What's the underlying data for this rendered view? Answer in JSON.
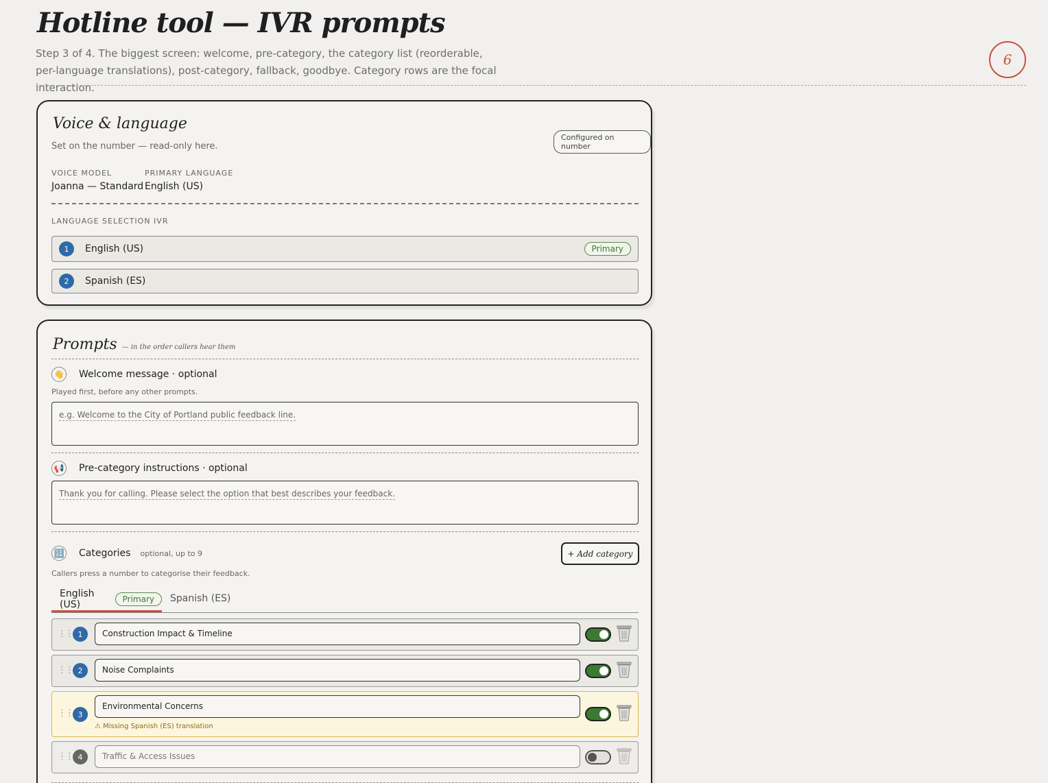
{
  "header": {
    "title": "Hotline tool — IVR prompts",
    "subtitle": "Step 3 of 4. The biggest screen: welcome, pre-category, the category list (reorderable, per-language translations), post-category, fallback, goodbye. Category rows are the focal interaction.",
    "step_number": "6"
  },
  "voice_card": {
    "title": "Voice & language",
    "subtitle": "Set on the number — read-only here.",
    "badge": "Configured on number",
    "voice_model_label": "VOICE MODEL",
    "voice_model_value": "Joanna — Standard",
    "primary_language_label": "PRIMARY LANGUAGE",
    "primary_language_value": "English (US)",
    "language_ivr_label": "LANGUAGE SELECTION IVR",
    "languages": [
      {
        "number": "1",
        "name": "English (US)",
        "badge": "Primary"
      },
      {
        "number": "2",
        "name": "Spanish (ES)",
        "badge": ""
      }
    ]
  },
  "prompts_card": {
    "title": "Prompts",
    "title_note": "— in the order callers hear them",
    "welcome": {
      "icon": "waving-hand-icon",
      "label": "Welcome message · optional",
      "hint": "Played first, before any other prompts.",
      "placeholder": "e.g. Welcome to the City of Portland public feedback line."
    },
    "pre_category": {
      "icon": "megaphone-icon",
      "label": "Pre-category instructions · optional",
      "placeholder": "Thank you for calling. Please select the option that best describes your feedback."
    },
    "categories": {
      "icon": "keypad-icon",
      "label": "Categories",
      "note": "optional, up to 9",
      "hint": "Callers press a number to categorise their feedback.",
      "add_button": "+ Add category",
      "tabs": [
        {
          "label": "English (US)",
          "badge": "Primary",
          "active": true
        },
        {
          "label": "Spanish (ES)",
          "badge": "",
          "active": false
        }
      ],
      "rows": [
        {
          "number": "1",
          "value": "Construction Impact & Timeline",
          "enabled": true,
          "warning": ""
        },
        {
          "number": "2",
          "value": "Noise Complaints",
          "enabled": true,
          "warning": ""
        },
        {
          "number": "3",
          "value": "Environmental Concerns",
          "enabled": true,
          "warning": "⚠ Missing Spanish (ES) translation"
        },
        {
          "number": "4",
          "value": "Traffic & Access Issues",
          "enabled": false,
          "warning": ""
        }
      ]
    }
  },
  "colors": {
    "accent": "#c3533b",
    "badge_blue": "#2e6aa8",
    "toggle_on": "#3b7a33",
    "primary_green": "#3e7a30",
    "warning_bg": "#fdf6df"
  }
}
